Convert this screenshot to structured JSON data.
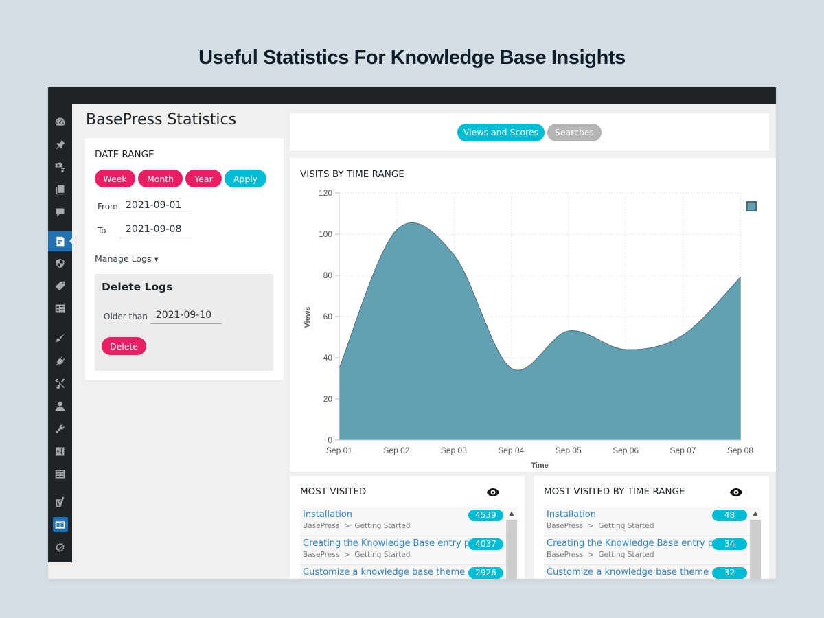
{
  "hero_title": "Useful Statistics For Knowledge Base Insights",
  "page_title": "BasePress Statistics",
  "sidebar": {
    "items": [
      {
        "icon": "dashboard-icon"
      },
      {
        "icon": "pin-icon"
      },
      {
        "icon": "media-icon"
      },
      {
        "icon": "pages-icon"
      },
      {
        "icon": "comments-icon"
      },
      {
        "icon": "document-icon",
        "active": true
      },
      {
        "icon": "shield-icon"
      },
      {
        "icon": "tag-icon"
      },
      {
        "icon": "list-icon"
      },
      {
        "icon": "brush-icon"
      },
      {
        "icon": "plugin-icon"
      },
      {
        "icon": "scissors-icon"
      },
      {
        "icon": "user-icon"
      },
      {
        "icon": "wrench-icon"
      },
      {
        "icon": "sliders-icon"
      },
      {
        "icon": "table-icon"
      },
      {
        "icon": "yoast-icon"
      },
      {
        "icon": "book-icon",
        "active": true
      },
      {
        "icon": "gear-slash-icon"
      }
    ]
  },
  "date_range": {
    "title": "DATE RANGE",
    "buttons": {
      "week": "Week",
      "month": "Month",
      "year": "Year",
      "apply": "Apply"
    },
    "from_label": "From",
    "from_value": "2021-09-01",
    "to_label": "To",
    "to_value": "2021-09-08",
    "manage_logs": "Manage Logs ▾",
    "delete_logs": {
      "title": "Delete Logs",
      "older_than_label": "Older than",
      "older_than_value": "2021-09-10",
      "delete_button": "Delete"
    }
  },
  "tabs": {
    "views_scores": "Views and Scores",
    "searches": "Searches",
    "active": "views_scores"
  },
  "colors": {
    "pink": "#e91e63",
    "cyan": "#00bcd4",
    "series": "#62a1b3",
    "series_stroke": "#4a6e79"
  },
  "chart_title": "VISITS BY TIME RANGE",
  "chart_data": {
    "type": "area",
    "title": "VISITS BY TIME RANGE",
    "xlabel": "Time",
    "ylabel": "Views",
    "categories": [
      "Sep 01",
      "Sep 02",
      "Sep 03",
      "Sep 04",
      "Sep 05",
      "Sep 06",
      "Sep 07",
      "Sep 08"
    ],
    "series": [
      {
        "name": "",
        "values": [
          35,
          102,
          90,
          35,
          53,
          44,
          51,
          79
        ]
      }
    ],
    "ylim": [
      0,
      120
    ],
    "yticks": [
      0,
      20,
      40,
      60,
      80,
      100,
      120
    ],
    "grid": true,
    "legend": "top-right",
    "smooth": true
  },
  "most_visited": {
    "title": "MOST VISITED",
    "items": [
      {
        "title": "Installation",
        "crumb_root": "BasePress",
        "crumb_section": "Getting Started",
        "count": "4539"
      },
      {
        "title": "Creating the Knowledge Base entry page",
        "crumb_root": "BasePress",
        "crumb_section": "Getting Started",
        "count": "4037"
      },
      {
        "title": "Customize a knowledge base theme",
        "crumb_root": "",
        "crumb_section": "",
        "count": "2926"
      }
    ]
  },
  "most_visited_range": {
    "title": "MOST VISITED BY TIME RANGE",
    "items": [
      {
        "title": "Installation",
        "crumb_root": "BasePress",
        "crumb_section": "Getting Started",
        "count": "48"
      },
      {
        "title": "Creating the Knowledge Base entry page",
        "crumb_root": "BasePress",
        "crumb_section": "Getting Started",
        "count": "34"
      },
      {
        "title": "Customize a knowledge base theme",
        "crumb_root": "",
        "crumb_section": "",
        "count": "32"
      }
    ]
  }
}
